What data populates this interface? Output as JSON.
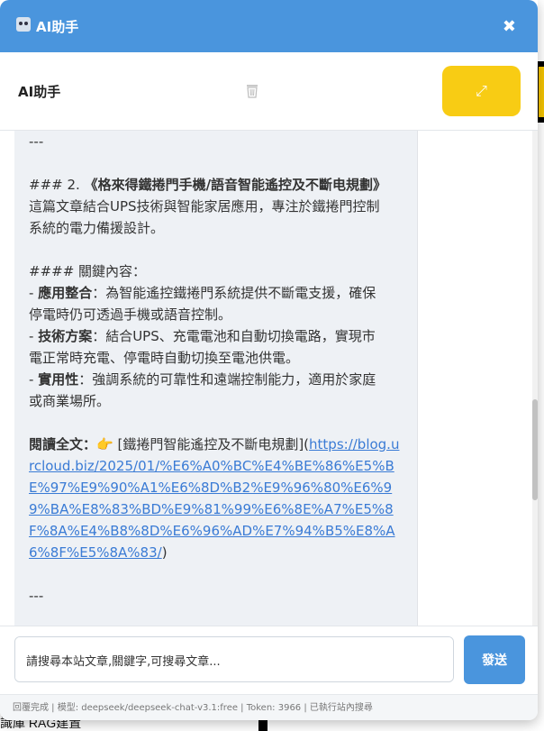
{
  "window": {
    "title": "AI助手",
    "close_glyph": "✖"
  },
  "header": {
    "title": "AI助手",
    "clear_icon": "trash-icon",
    "expand_glyph": "⤢",
    "accent_yellow": "#f8cc14",
    "accent_blue": "#4a95dd"
  },
  "message": {
    "lines": [
      "---",
      "",
      "### 2. 《格來得鐵捲門手機/語音智能遙控及不斷電規劃》",
      "這篇文章結合UPS技術與智能家居應用，專注於鐵捲門控制",
      "系統的電力備援設計。",
      "",
      "#### 關鍵內容：",
      "- 應用整合：為智能遙控鐵捲門系統提供不斷電支援，確保",
      "停電時仍可透過手機或語音控制。",
      "- 技術方案：結合UPS、充電電池和自動切換電路，實現市",
      "電正常時充電、停電時自動切換至電池供電。",
      "- 實用性：強調系統的可靠性和遠端控制能力，適用於家庭",
      "或商業場所。",
      "",
      "閱讀全文：👉 [鐵捲門智能遙控及不斷电規劃](",
      "https://blog.urcloud.biz/2025/01/%E6%A0%BC%E4%BE%86%E5%BE%97%E9%90%A1%E6%8D%B2%E9%96%80%E6%99%BA%E8%83%BD%E9%81%99%E6%8E%A7%E5%8F%8A%E4%B8%8D%E6%96%AD%E7%94%B5%E8%A6%8F%E5%8A%83/",
      ")",
      "",
      "---"
    ],
    "heading_2": "### 2. 《格來得鐵捲門手機/語音智能遙控及不斷电規劃》",
    "intro_1": "這篇文章結合UPS技術與智能家居應用，專注於鐵捲門控制",
    "intro_2": "系統的電力備援設計。",
    "heading_4": "#### 關鍵內容：",
    "bullet_1_label": "應用整合",
    "bullet_1_text_1": "：為智能遙控鐵捲門系統提供不斷電支援，確保",
    "bullet_1_text_2": "停電時仍可透過手機或語音控制。",
    "bullet_2_label": "技術方案",
    "bullet_2_text_1": "：結合UPS、充電電池和自動切換電路，實現市",
    "bullet_2_text_2": "電正常時充電、停電時自動切換至電池供電。",
    "bullet_3_label": "實用性",
    "bullet_3_text_1": "：強調系統的可靠性和遠端控制能力，適用於家庭",
    "bullet_3_text_2": "或商業場所。",
    "read_more_label": "閱讀全文：",
    "read_more_emoji": "👉",
    "link_text_prefix": " [鐵捲門智能遙控及不斷电規劃](",
    "link_url": "https://blog.urcloud.biz/2025/01/%E6%A0%BC%E4%BE%86%E5%BE%97%E9%90%A1%E6%8D%B2%E9%96%80%E6%99%BA%E8%83%BD%E9%81%99%E6%8E%A7%E5%8F%8A%E4%B8%8D%E6%96%AD%E7%94%B5%E8%A6%8F%E5%8A%83/",
    "link_close": ")",
    "separator": "---"
  },
  "input": {
    "placeholder": "請搜尋本站文章,關鍵字,可搜尋文章...",
    "send_label": "發送"
  },
  "status": {
    "text": "回覆完成 | 模型: deepseek/deepseek-chat-v3.1:free | Token: 3966 | 已執行站內搜尋"
  },
  "background": {
    "bottom_text": "識庫 RAG建置"
  }
}
